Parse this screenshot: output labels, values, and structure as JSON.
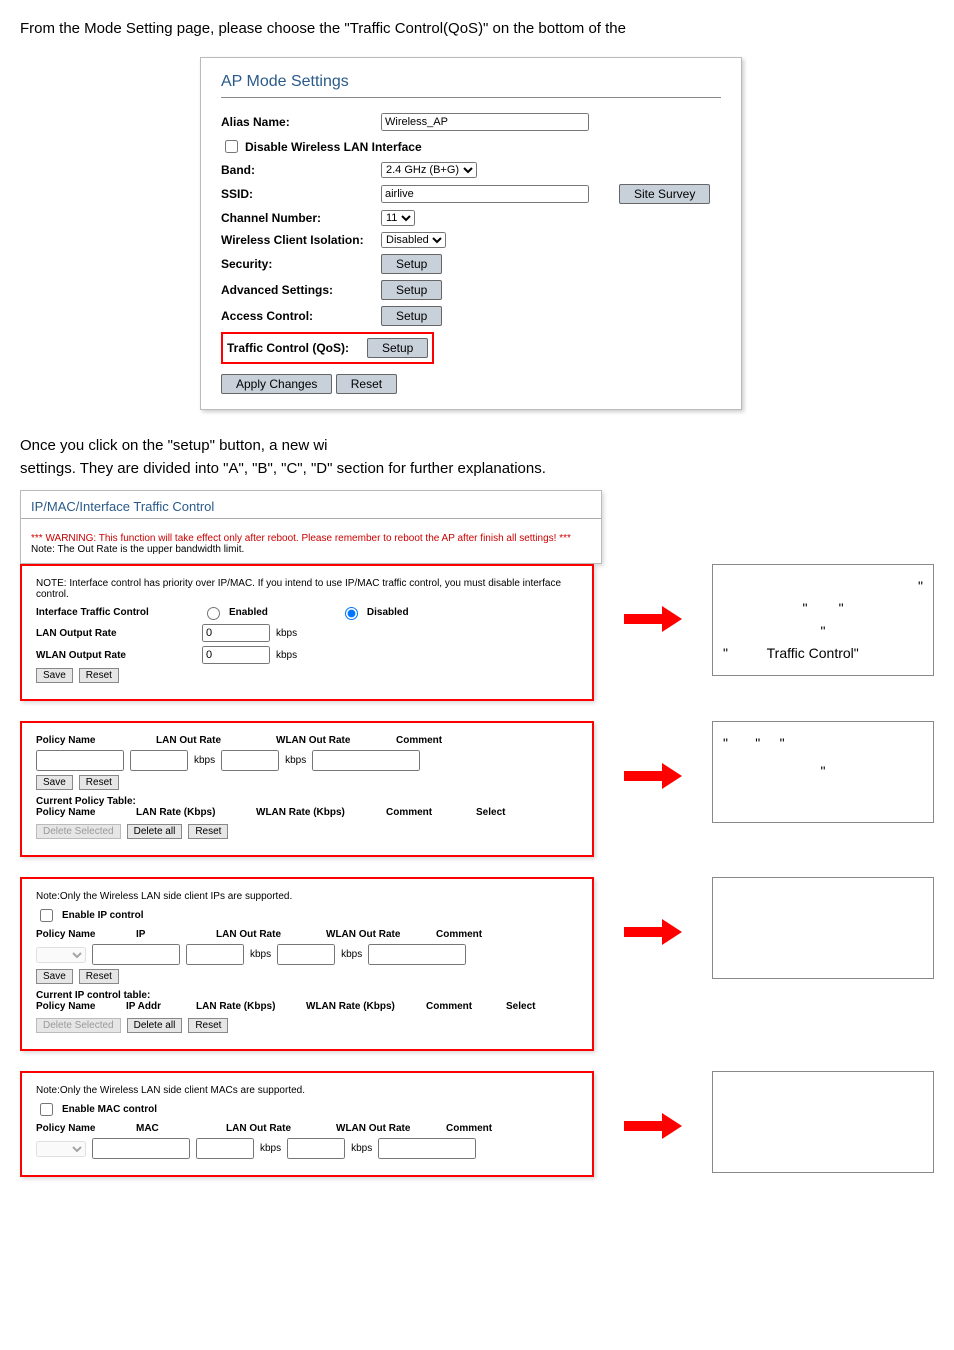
{
  "intro": "From the Mode Setting page, please choose the \"Traffic Control(QoS)\" on the bottom of the",
  "ap": {
    "title": "AP Mode Settings",
    "alias_label": "Alias Name:",
    "alias_value": "Wireless_AP",
    "disable_wlan_label": "Disable Wireless LAN Interface",
    "band_label": "Band:",
    "band_value": "2.4 GHz (B+G)",
    "ssid_label": "SSID:",
    "ssid_value": "airlive",
    "site_survey": "Site Survey",
    "channel_label": "Channel Number:",
    "channel_value": "11",
    "wci_label": "Wireless Client Isolation:",
    "wci_value": "Disabled",
    "security_label": "Security:",
    "adv_label": "Advanced Settings:",
    "acc_label": "Access Control:",
    "qos_label": "Traffic Control (QoS):",
    "setup_btn": "Setup",
    "apply": "Apply Changes",
    "reset": "Reset"
  },
  "mid_text_1": "Once you click on the \"setup\" button, a new wi",
  "mid_text_2": "settings.    They are divided into \"A\", \"B\", \"C\", \"D\" section for further explanations.",
  "ipmac": {
    "title": "IP/MAC/Interface Traffic Control",
    "warn": "*** WARNING: This function will take effect only after reboot. Please remember to reboot the AP after finish all settings! ***",
    "note_out": "Note: The Out Rate is the upper bandwidth limit.",
    "sectA": {
      "note": "NOTE: Interface control has priority over IP/MAC. If you intend to use IP/MAC traffic control, you must disable interface control.",
      "itc_label": "Interface Traffic Control",
      "enabled": "Enabled",
      "disabled": "Disabled",
      "lan_label": "LAN Output Rate",
      "wlan_label": "WLAN Output Rate",
      "lan_val": "0",
      "wlan_val": "0",
      "kbps": "kbps",
      "save": "Save",
      "reset": "Reset"
    },
    "sectB": {
      "hdr_policy": "Policy Name",
      "hdr_lan": "LAN Out Rate",
      "hdr_wlan": "WLAN Out Rate",
      "hdr_comment": "Comment",
      "kbps": "kbps",
      "save": "Save",
      "reset": "Reset",
      "cur_table": "Current Policy Table:",
      "hdr_policy2": "Policy Name",
      "hdr_lanr": "LAN Rate (Kbps)",
      "hdr_wlanr": "WLAN Rate (Kbps)",
      "hdr_comment2": "Comment",
      "hdr_select": "Select",
      "del_sel": "Delete Selected",
      "del_all": "Delete all",
      "reset2": "Reset"
    },
    "sectC": {
      "note": "Note:Only the Wireless LAN side client IPs are supported.",
      "enable_ip": "Enable IP control",
      "hdr_policy": "Policy Name",
      "hdr_ip": "IP",
      "hdr_lan": "LAN Out Rate",
      "hdr_wlan": "WLAN Out Rate",
      "hdr_comment": "Comment",
      "kbps": "kbps",
      "save": "Save",
      "reset": "Reset",
      "cur_table": "Current IP control table:",
      "hdr_policy2": "Policy Name",
      "hdr_ipaddr": "IP Addr",
      "hdr_lanr": "LAN Rate (Kbps)",
      "hdr_wlanr": "WLAN Rate (Kbps)",
      "hdr_comment2": "Comment",
      "hdr_select": "Select",
      "del_sel": "Delete Selected",
      "del_all": "Delete all",
      "reset2": "Reset"
    },
    "sectD": {
      "note": "Note:Only the Wireless LAN side client MACs are supported.",
      "enable_mac": "Enable MAC control",
      "hdr_policy": "Policy Name",
      "hdr_mac": "MAC",
      "hdr_lan": "LAN Out Rate",
      "hdr_wlan": "WLAN Out Rate",
      "hdr_comment": "Comment",
      "kbps": "kbps"
    }
  },
  "side": {
    "a1": "\"",
    "a2": "\"",
    "a3": "\"",
    "a4": "\"",
    "a5": "\"",
    "a6": "Traffic Control\"",
    "b1": "\"",
    "b2": "\"",
    "b3": "\"",
    "b4": "\""
  }
}
